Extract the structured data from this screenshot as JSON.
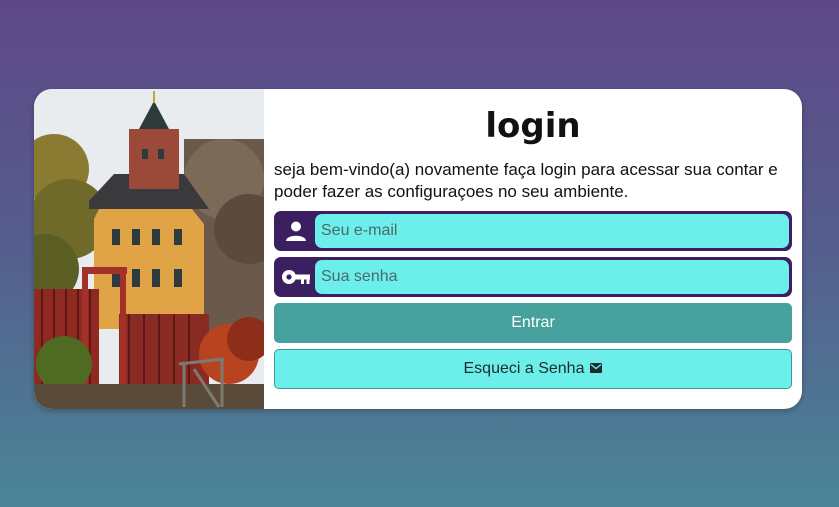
{
  "login": {
    "title": "login",
    "description": "seja bem-vindo(a) novamente faça login para acessar sua contar e poder fazer as configuraçoes no seu ambiente.",
    "email": {
      "placeholder": "Seu e-mail",
      "value": "",
      "icon": "user-icon"
    },
    "password": {
      "placeholder": "Sua senha",
      "value": "",
      "icon": "key-icon"
    },
    "submit_label": "Entrar",
    "forgot_label": "Esqueci a Senha",
    "forgot_icon": "envelope-icon"
  },
  "colors": {
    "background_top": "#5e4787",
    "background_bottom": "#4a8597",
    "field_border": "#3b1f61",
    "field_fill": "#6ceeea",
    "submit_button": "#46a19c",
    "forgot_button": "#6ceeea"
  }
}
